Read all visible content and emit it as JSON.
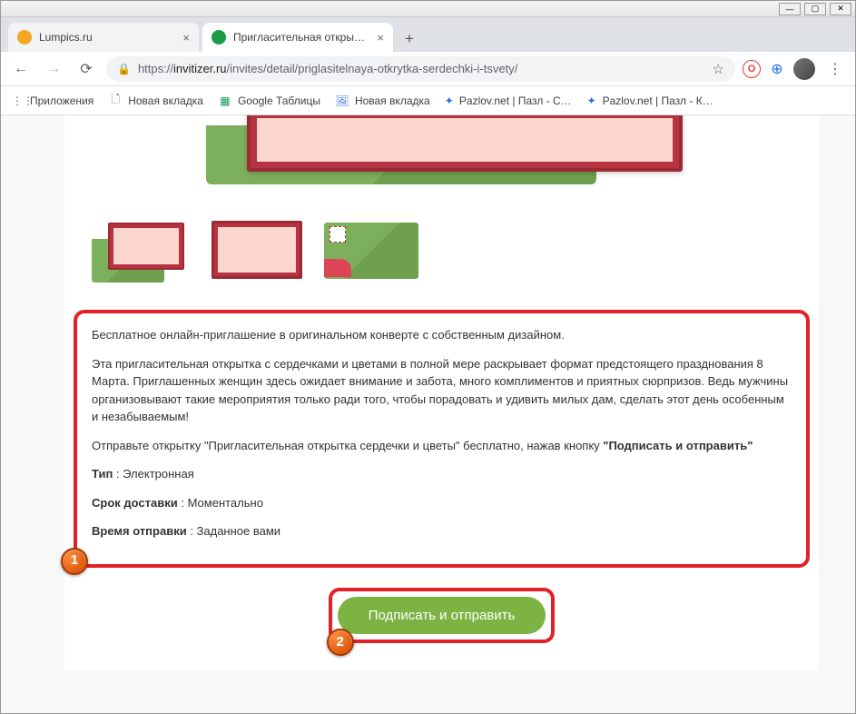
{
  "window": {
    "min": "—",
    "max": "▢",
    "close": "✕"
  },
  "tabs": [
    {
      "title": "Lumpics.ru",
      "favicon_color": "#f5a623",
      "active": false
    },
    {
      "title": "Пригласительная открытка сер…",
      "favicon_color": "#1a9c47",
      "active": true
    }
  ],
  "nav": {
    "back": "←",
    "forward": "→",
    "reload": "⟳"
  },
  "url": {
    "scheme": "https://",
    "host": "invitizer.ru",
    "path": "/invites/detail/priglasitelnaya-otkrytka-serdechki-i-tsvety/"
  },
  "toolbar_icons": {
    "star": "☆",
    "opera": "O",
    "globe": "⊕",
    "menu": "⋮"
  },
  "bookmarks": [
    {
      "icon": "⋮⋮⋮",
      "icon_color": "#5f6368",
      "label": "Приложения"
    },
    {
      "icon": "🗋",
      "icon_color": "#5f6368",
      "label": "Новая вкладка"
    },
    {
      "icon": "▦",
      "icon_color": "#0f9d58",
      "label": "Google Таблицы"
    },
    {
      "icon": "🖼",
      "icon_color": "#3b78e7",
      "label": "Новая вкладка"
    },
    {
      "icon": "✦",
      "icon_color": "#1a73e8",
      "label": "Pazlov.net | Пазл - С…"
    },
    {
      "icon": "✦",
      "icon_color": "#1a73e8",
      "label": "Pazlov.net | Пазл - К…"
    }
  ],
  "description": {
    "p1": "Бесплатное онлайн-приглашение в оригинальном конверте с собственным дизайном.",
    "p2": "Эта пригласительная открытка с сердечками и цветами в полной мере раскрывает формат предстоящего празднования 8 Марта. Приглашенных женщин здесь ожидает внимание и забота, много комплиментов и приятных сюрпризов. Ведь мужчины организовывают такие мероприятия только ради того, чтобы порадовать и удивить милых дам, сделать этот день особенным и незабываемым!",
    "p3_pre": "Отправьте открытку \"Пригласительная открытка сердечки и цветы\" бесплатно, нажав кнопку ",
    "p3_bold": "\"Подписать и отправить\"",
    "type_label": "Тип",
    "type_value": " : Электронная",
    "delivery_label": "Срок доставки",
    "delivery_value": " : Моментально",
    "send_label": "Время отправки",
    "send_value": " : Заданное вами"
  },
  "cta": "Подписать и отправить",
  "badges": {
    "one": "1",
    "two": "2"
  }
}
